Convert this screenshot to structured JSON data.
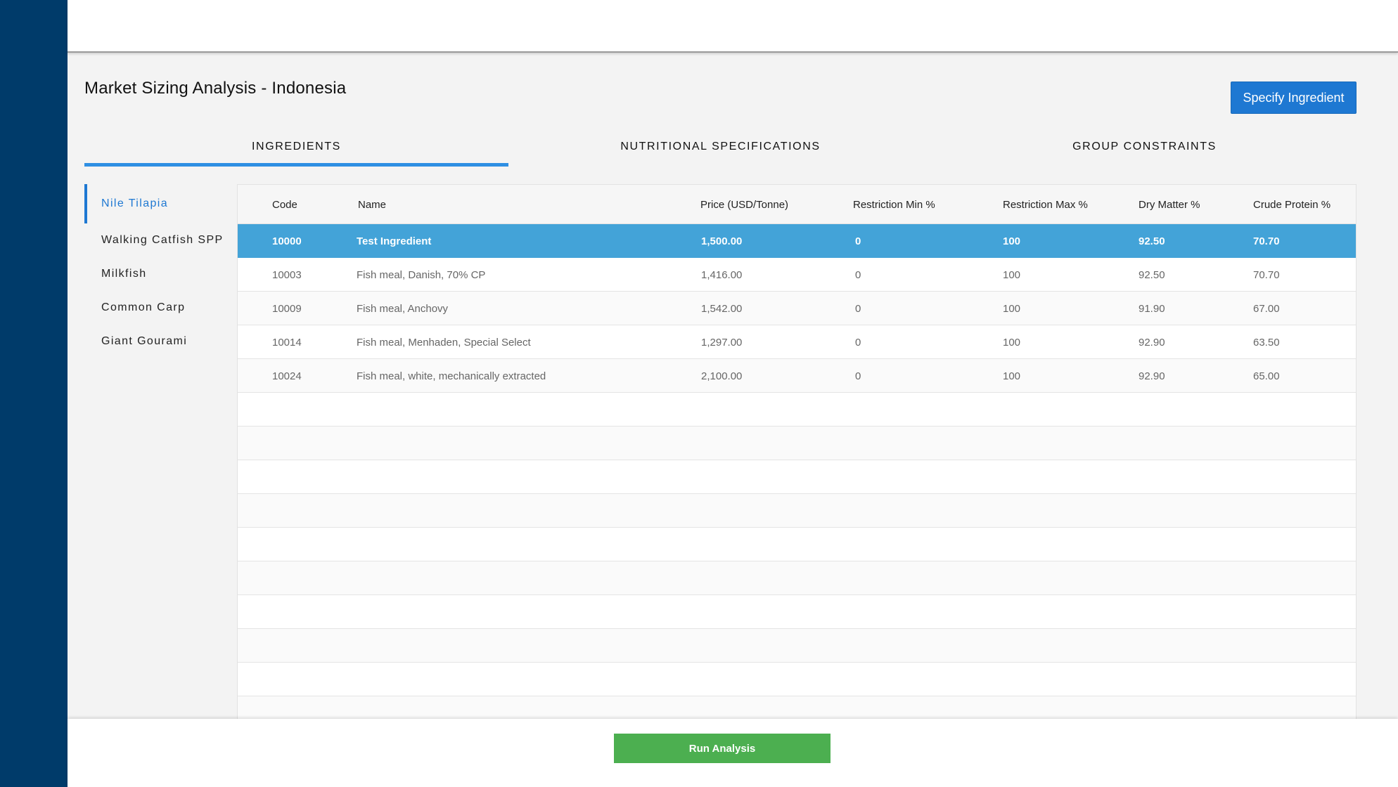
{
  "page": {
    "title": "Market Sizing Analysis - Indonesia"
  },
  "actions": {
    "specify_label": "Specify Ingredient",
    "run_label": "Run Analysis"
  },
  "tabs": [
    {
      "label": "INGREDIENTS",
      "active": true
    },
    {
      "label": "NUTRITIONAL SPECIFICATIONS",
      "active": false
    },
    {
      "label": "GROUP CONSTRAINTS",
      "active": false
    }
  ],
  "species": [
    {
      "label": "Nile Tilapia",
      "active": true
    },
    {
      "label": "Walking Catfish SPP",
      "active": false
    },
    {
      "label": "Milkfish",
      "active": false
    },
    {
      "label": "Common Carp",
      "active": false
    },
    {
      "label": "Giant Gourami",
      "active": false
    }
  ],
  "table": {
    "columns": [
      "Code",
      "Name",
      "Price (USD/Tonne)",
      "Restriction Min %",
      "Restriction Max %",
      "Dry Matter %",
      "Crude Protein %"
    ],
    "rows": [
      {
        "selected": true,
        "code": "10000",
        "name": "Test Ingredient",
        "price": "1,500.00",
        "rmin": "0",
        "rmax": "100",
        "dm": "92.50",
        "cp": "70.70"
      },
      {
        "selected": false,
        "code": "10003",
        "name": "Fish meal, Danish, 70% CP",
        "price": "1,416.00",
        "rmin": "0",
        "rmax": "100",
        "dm": "92.50",
        "cp": "70.70"
      },
      {
        "selected": false,
        "code": "10009",
        "name": "Fish meal, Anchovy",
        "price": "1,542.00",
        "rmin": "0",
        "rmax": "100",
        "dm": "91.90",
        "cp": "67.00"
      },
      {
        "selected": false,
        "code": "10014",
        "name": "Fish meal, Menhaden, Special Select",
        "price": "1,297.00",
        "rmin": "0",
        "rmax": "100",
        "dm": "92.90",
        "cp": "63.50"
      },
      {
        "selected": false,
        "code": "10024",
        "name": "Fish meal, white, mechanically extracted",
        "price": "2,100.00",
        "rmin": "0",
        "rmax": "100",
        "dm": "92.90",
        "cp": "65.00"
      }
    ]
  },
  "colors": {
    "rail": "#003b6a",
    "accent": "#1e78d2",
    "selected_row": "#43a3d8",
    "run_button": "#4caf50"
  }
}
